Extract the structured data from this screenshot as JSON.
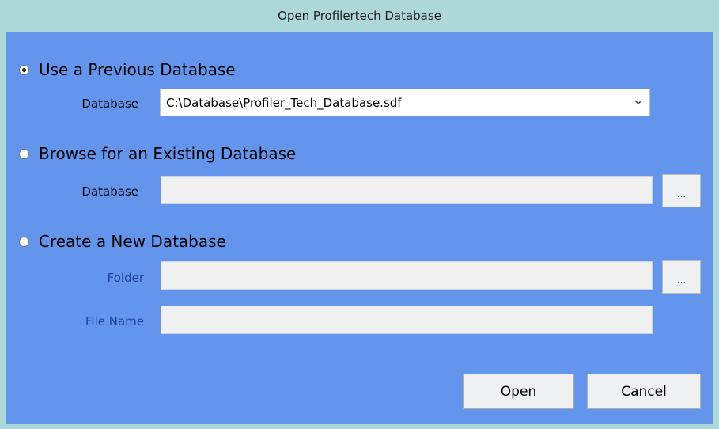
{
  "window": {
    "title": "Open Profilertech Database"
  },
  "options": {
    "previous": {
      "label": "Use a Previous Database",
      "selected": true
    },
    "browse": {
      "label": "Browse for an Existing Database",
      "selected": false
    },
    "create": {
      "label": "Create a New Database",
      "selected": false
    }
  },
  "previous": {
    "database_label": "Database",
    "database_value": "C:\\Database\\Profiler_Tech_Database.sdf"
  },
  "browse": {
    "database_label": "Database",
    "database_value": "",
    "browse_button": "..."
  },
  "create": {
    "folder_label": "Folder",
    "folder_value": "",
    "folder_browse_button": "...",
    "filename_label": "File Name",
    "filename_value": ""
  },
  "buttons": {
    "open": "Open",
    "cancel": "Cancel"
  },
  "colors": {
    "titlebar_bg": "#aed7d7",
    "content_bg": "#6495ed",
    "muted_label": "#1f3fa0"
  }
}
